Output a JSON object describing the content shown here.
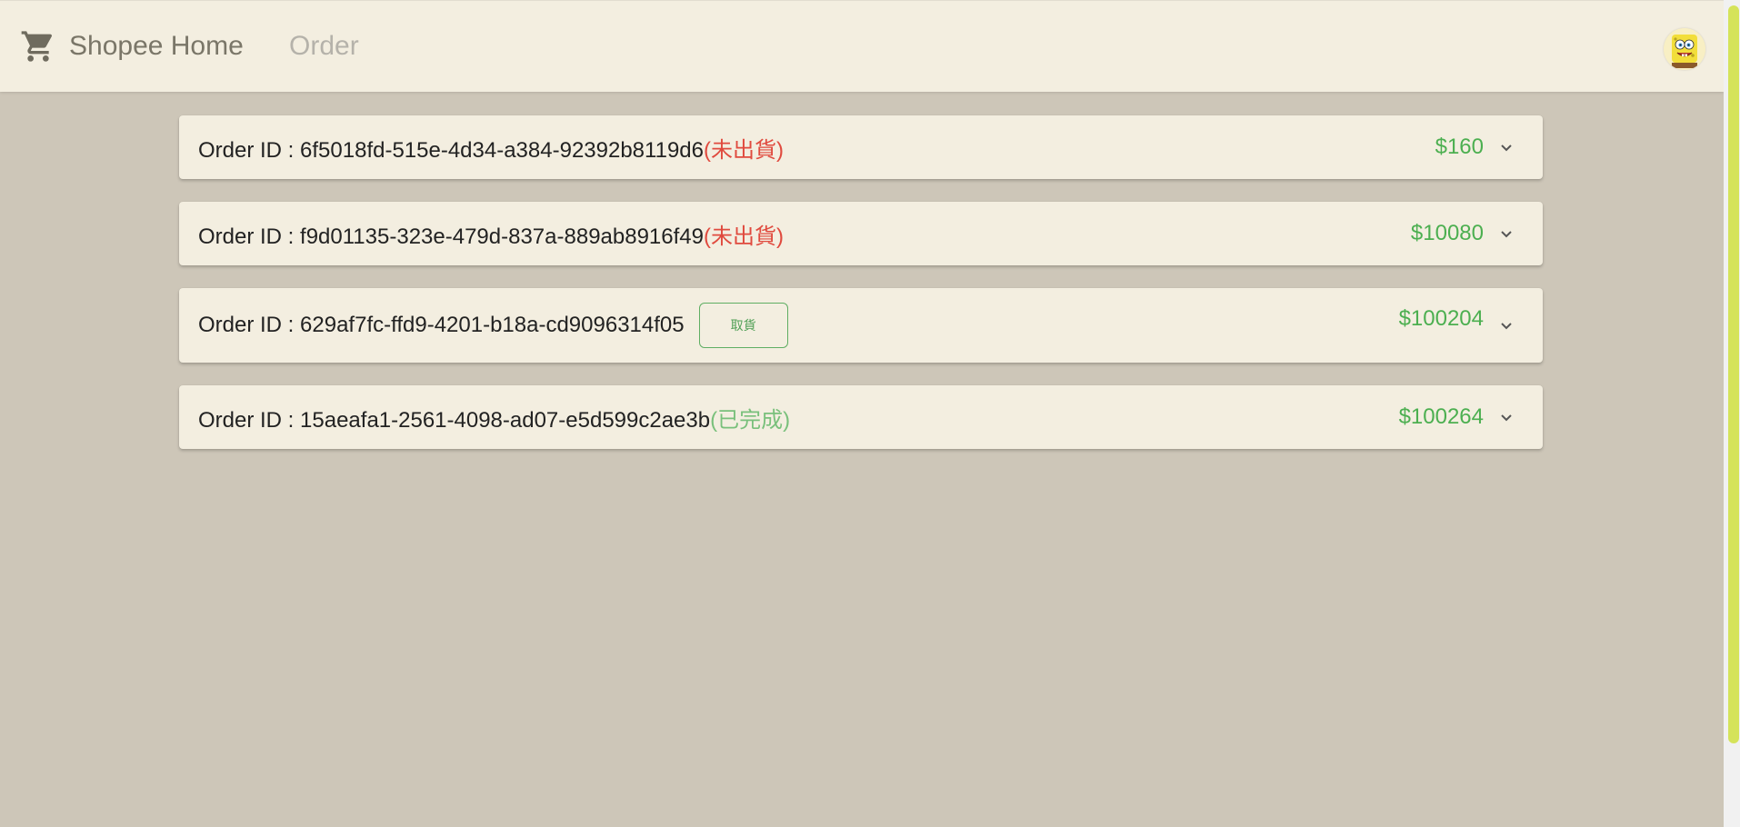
{
  "header": {
    "brand_label": "Shopee Home",
    "nav_order_label": "Order",
    "brand_icon": "shopping-cart-icon",
    "avatar": "spongebob-avatar"
  },
  "colors": {
    "page_bg": "#cdc6b8",
    "card_bg": "#f3eee0",
    "price_green": "#4caf50",
    "status_red": "#e04a3e",
    "status_green": "#79c07b",
    "scrollbar": "#d5e35a"
  },
  "orders": [
    {
      "prefix": "Order ID : ",
      "id": "6f5018fd-515e-4d34-a384-92392b8119d6",
      "status": "(未出貨)",
      "price": "$160",
      "chevron_icon": "chevron-down-icon"
    },
    {
      "prefix": "Order ID : ",
      "id": "f9d01135-323e-479d-837a-889ab8916f49",
      "status": "(未出貨)",
      "price": "$10080",
      "chevron_icon": "chevron-down-icon"
    },
    {
      "prefix": "Order ID : ",
      "id": "629af7fc-ffd9-4201-b18a-cd9096314f05",
      "action_label": "取貨",
      "price": "$100204",
      "chevron_icon": "chevron-down-icon"
    },
    {
      "prefix": "Order ID : ",
      "id": "15aeafa1-2561-4098-ad07-e5d599c2ae3b",
      "status": "(已完成)",
      "price": "$100264",
      "chevron_icon": "chevron-down-icon"
    }
  ]
}
